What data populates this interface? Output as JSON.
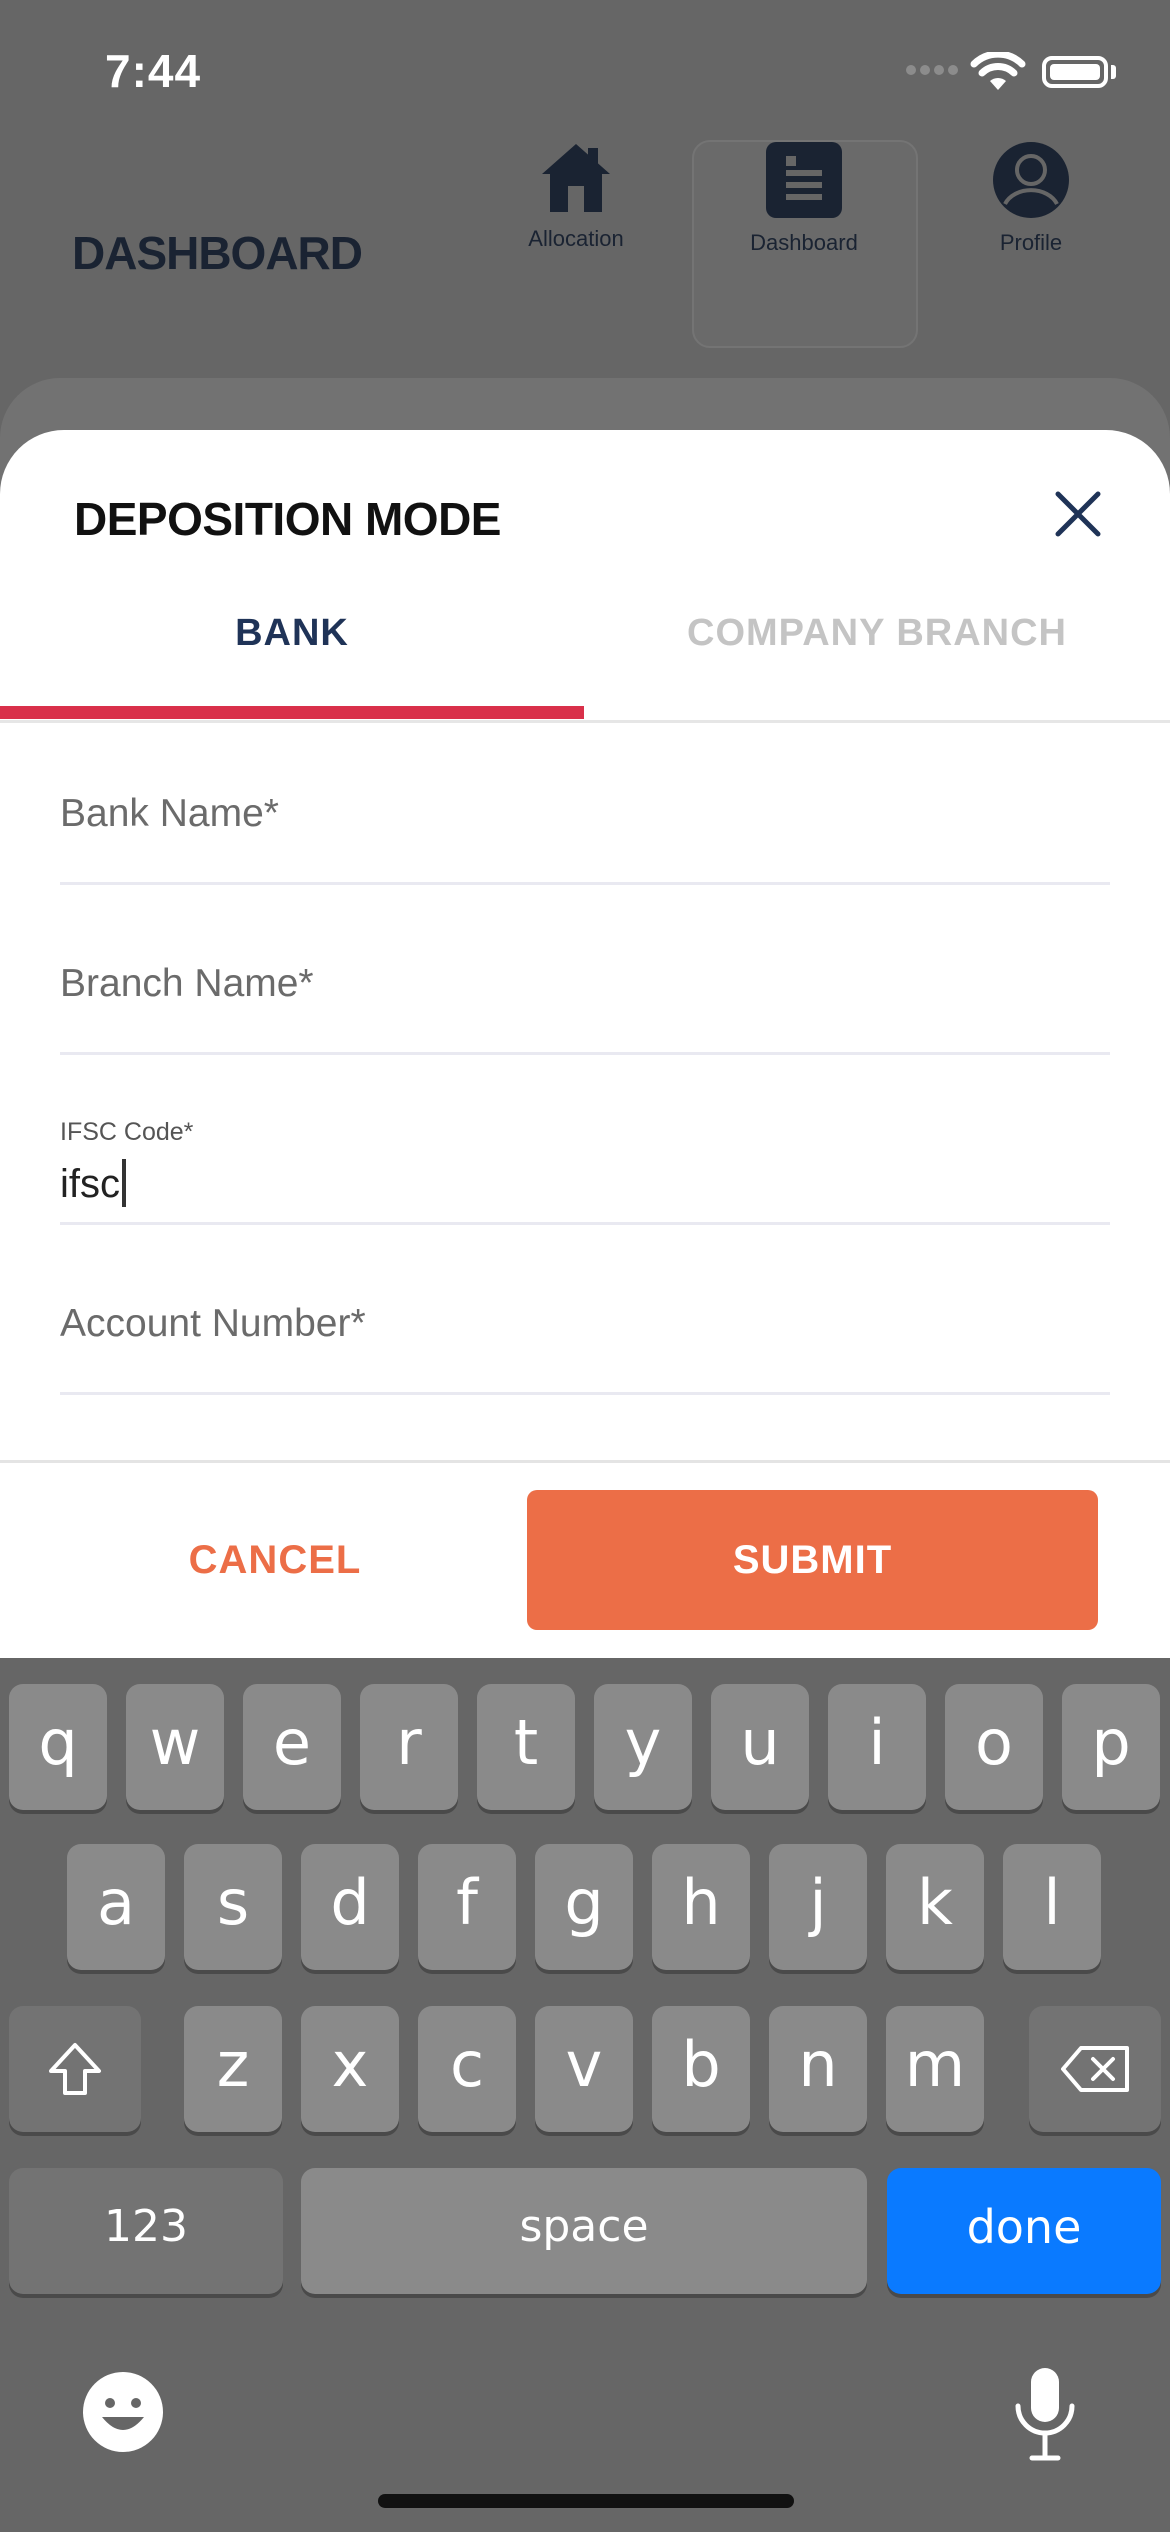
{
  "status_bar": {
    "time": "7:44"
  },
  "header": {
    "title": "DASHBOARD",
    "nav": [
      {
        "label": "Allocation",
        "icon": "home-icon"
      },
      {
        "label": "Dashboard",
        "icon": "dashboard-icon",
        "active": true
      },
      {
        "label": "Profile",
        "icon": "profile-icon"
      }
    ]
  },
  "modal": {
    "title": "DEPOSITION MODE",
    "tabs": [
      {
        "label": "BANK",
        "active": true
      },
      {
        "label": "COMPANY BRANCH",
        "active": false
      }
    ],
    "fields": [
      {
        "label": "Bank Name*",
        "value": ""
      },
      {
        "label": "Branch Name*",
        "value": ""
      },
      {
        "label": "IFSC Code*",
        "value": "ifsc",
        "focused": true
      },
      {
        "label": "Account Number*",
        "value": ""
      }
    ],
    "cancel_label": "CANCEL",
    "submit_label": "SUBMIT"
  },
  "keyboard": {
    "row1": [
      "q",
      "w",
      "e",
      "r",
      "t",
      "y",
      "u",
      "i",
      "o",
      "p"
    ],
    "row2": [
      "a",
      "s",
      "d",
      "f",
      "g",
      "h",
      "j",
      "k",
      "l"
    ],
    "row3": [
      "z",
      "x",
      "c",
      "v",
      "b",
      "n",
      "m"
    ],
    "numbers_label": "123",
    "space_label": "space",
    "done_label": "done"
  },
  "colors": {
    "accent": "#ec6e47",
    "tab_indicator": "#d9304a",
    "tab_active": "#1f3357",
    "keyboard_done": "#0a7aff"
  }
}
